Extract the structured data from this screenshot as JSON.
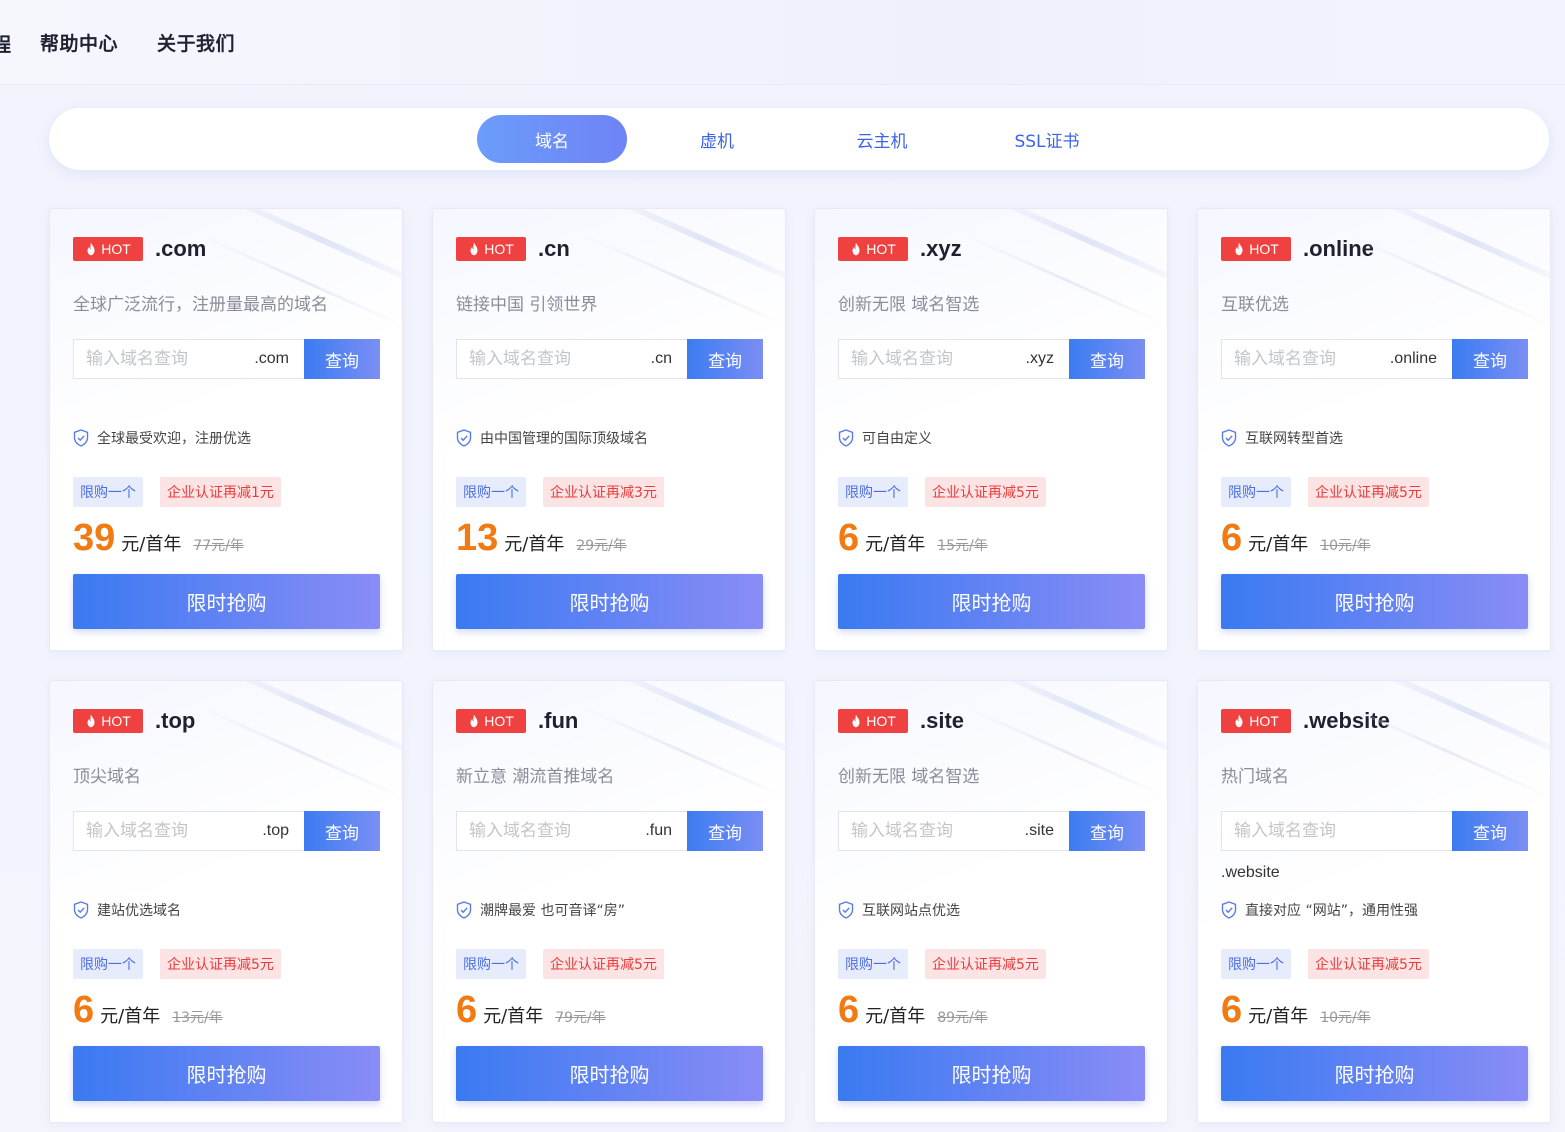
{
  "nav": {
    "cut_label": "程",
    "help": "帮助中心",
    "about": "关于我们"
  },
  "tabs": [
    "域名",
    "虚机",
    "云主机",
    "SSL证书"
  ],
  "common": {
    "hot": "HOT",
    "placeholder": "输入域名查询",
    "query": "查询",
    "limit_tag": "限购一个",
    "unit": "元/首年",
    "buy": "限时抢购"
  },
  "cards": [
    {
      "tld": ".com",
      "desc": "全球广泛流行，注册量最高的域名",
      "suffix": ".com",
      "feature": "全球最受欢迎，注册优选",
      "discount": "企业认证再减1元",
      "price": "39",
      "orig": "77元/年"
    },
    {
      "tld": ".cn",
      "desc": "链接中国 引领世界",
      "suffix": ".cn",
      "feature": "由中国管理的国际顶级域名",
      "discount": "企业认证再减3元",
      "price": "13",
      "orig": "29元/年"
    },
    {
      "tld": ".xyz",
      "desc": "创新无限 域名智选",
      "suffix": ".xyz",
      "feature": "可自由定义",
      "discount": "企业认证再减5元",
      "price": "6",
      "orig": "15元/年"
    },
    {
      "tld": ".online",
      "desc": "互联优选",
      "suffix": ".online",
      "feature": "互联网转型首选",
      "discount": "企业认证再减5元",
      "price": "6",
      "orig": "10元/年"
    },
    {
      "tld": ".top",
      "desc": "顶尖域名",
      "suffix": ".top",
      "feature": "建站优选域名",
      "discount": "企业认证再减5元",
      "price": "6",
      "orig": "13元/年"
    },
    {
      "tld": ".fun",
      "desc": "新立意 潮流首推域名",
      "suffix": ".fun",
      "feature": "潮牌最爱 也可音译“房”",
      "discount": "企业认证再减5元",
      "price": "6",
      "orig": "79元/年"
    },
    {
      "tld": ".site",
      "desc": "创新无限 域名智选",
      "suffix": ".site",
      "feature": "互联网站点优选",
      "discount": "企业认证再减5元",
      "price": "6",
      "orig": "89元/年"
    },
    {
      "tld": ".website",
      "desc": "热门域名",
      "suffix": ".website",
      "feature": "直接对应 “网站”，通用性强",
      "discount": "企业认证再减5元",
      "price": "6",
      "orig": "10元/年"
    }
  ]
}
